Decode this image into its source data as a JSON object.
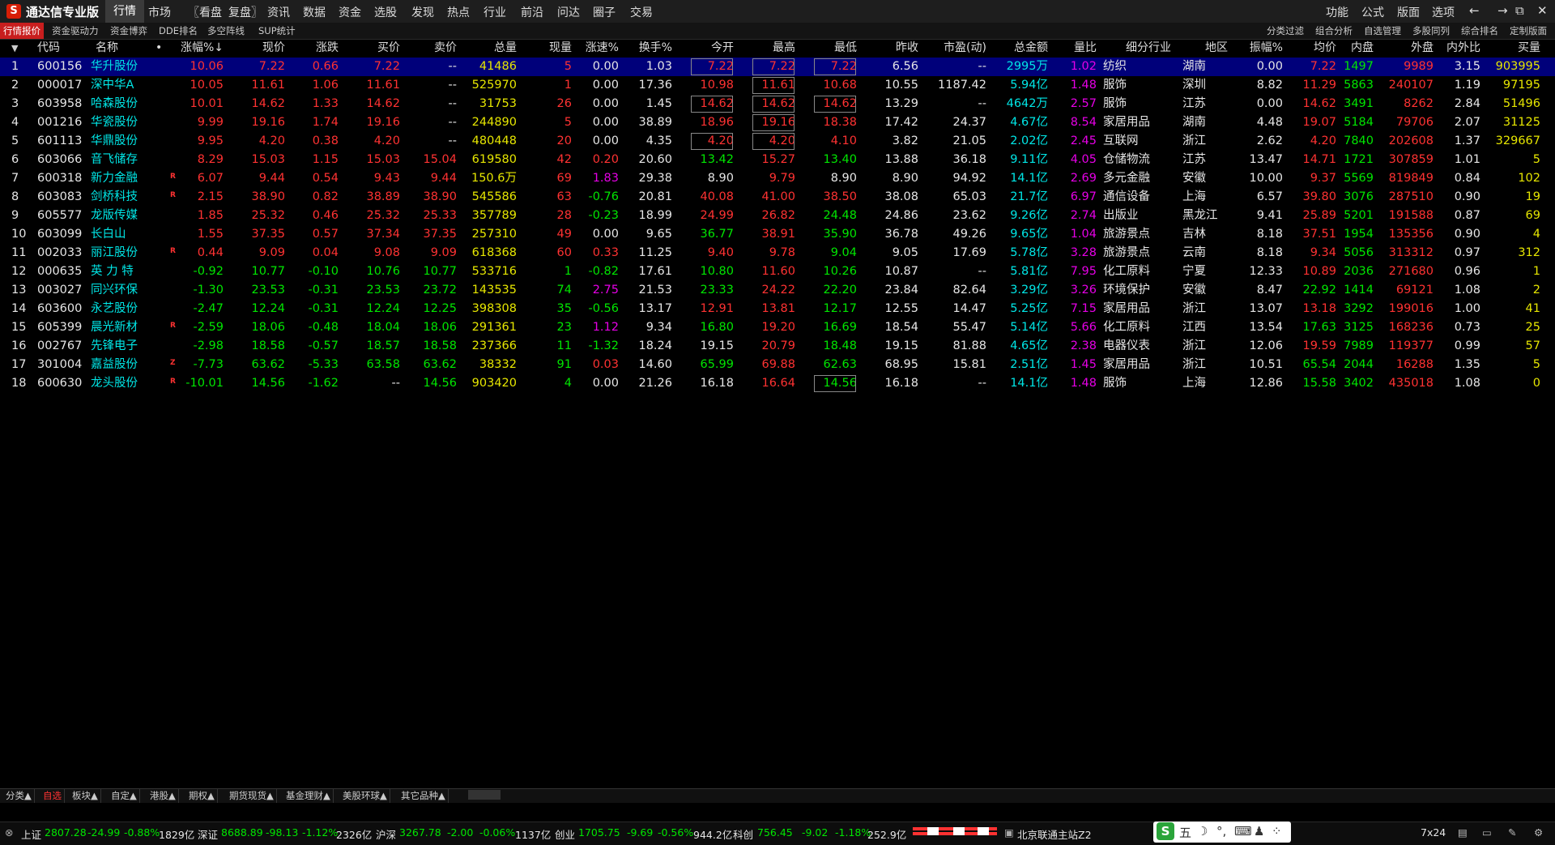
{
  "app": {
    "title": "通达信专业版",
    "logo_text": "S"
  },
  "menu": [
    "行情",
    "市场",
    "〖看盘",
    "复盘〗",
    "资讯",
    "数据",
    "资金",
    "选股",
    "发现",
    "热点",
    "行业",
    "前沿",
    "问达",
    "圈子",
    "交易"
  ],
  "right_menu": [
    "功能",
    "公式",
    "版面",
    "选项"
  ],
  "window_buttons": [
    "←",
    "→",
    "⧉",
    "✕"
  ],
  "tabs": [
    "行情报价",
    "资金驱动力",
    "资金博弈",
    "DDE排名",
    "多空阵线",
    "SUP统计"
  ],
  "right_tabs": [
    "分类过滤",
    "组合分析",
    "自选管理",
    "多股同列",
    "综合排名",
    "定制版面"
  ],
  "columns": [
    "代码",
    "名称",
    "•",
    "涨幅%↓",
    "现价",
    "涨跌",
    "买价",
    "卖价",
    "总量",
    "现量",
    "涨速%",
    "换手%",
    "今开",
    "最高",
    "最低",
    "昨收",
    "市盈(动)",
    "总金额",
    "量比",
    "细分行业",
    "地区",
    "振幅%",
    "均价",
    "内盘",
    "外盘",
    "内外比",
    "买量"
  ],
  "rows": [
    {
      "n": "1",
      "code": "600156",
      "name": "华升股份",
      "mk": "",
      "chg": "10.06",
      "px": "7.22",
      "zd": "0.66",
      "buy": "7.22",
      "sell": "--",
      "vol": "41486",
      "xl": "5",
      "spd": "0.00",
      "hs": "1.03",
      "open": "7.22",
      "high": "7.22",
      "low": "7.22",
      "pc": "6.56",
      "pe": "--",
      "amt": "2995万",
      "lb": "1.02",
      "ind": "纺织",
      "reg": "湖南",
      "amp": "0.00",
      "avg": "7.22",
      "np": "1497",
      "wp": "9989",
      "nwb": "3.15",
      "bv": "903995"
    },
    {
      "n": "2",
      "code": "000017",
      "name": "深中华A",
      "mk": "",
      "chg": "10.05",
      "px": "11.61",
      "zd": "1.06",
      "buy": "11.61",
      "sell": "--",
      "vol": "525970",
      "xl": "1",
      "spd": "0.00",
      "hs": "17.36",
      "open": "10.98",
      "high": "11.61",
      "low": "10.68",
      "pc": "10.55",
      "pe": "1187.42",
      "amt": "5.94亿",
      "lb": "1.48",
      "ind": "服饰",
      "reg": "深圳",
      "amp": "8.82",
      "avg": "11.29",
      "np": "5863",
      "wp": "240107",
      "nwb": "1.19",
      "bv": "97195"
    },
    {
      "n": "3",
      "code": "603958",
      "name": "哈森股份",
      "mk": "",
      "chg": "10.01",
      "px": "14.62",
      "zd": "1.33",
      "buy": "14.62",
      "sell": "--",
      "vol": "31753",
      "xl": "26",
      "spd": "0.00",
      "hs": "1.45",
      "open": "14.62",
      "high": "14.62",
      "low": "14.62",
      "pc": "13.29",
      "pe": "--",
      "amt": "4642万",
      "lb": "2.57",
      "ind": "服饰",
      "reg": "江苏",
      "amp": "0.00",
      "avg": "14.62",
      "np": "3491",
      "wp": "8262",
      "nwb": "2.84",
      "bv": "51496"
    },
    {
      "n": "4",
      "code": "001216",
      "name": "华瓷股份",
      "mk": "",
      "chg": "9.99",
      "px": "19.16",
      "zd": "1.74",
      "buy": "19.16",
      "sell": "--",
      "vol": "244890",
      "xl": "5",
      "spd": "0.00",
      "hs": "38.89",
      "open": "18.96",
      "high": "19.16",
      "low": "18.38",
      "pc": "17.42",
      "pe": "24.37",
      "amt": "4.67亿",
      "lb": "8.54",
      "ind": "家居用品",
      "reg": "湖南",
      "amp": "4.48",
      "avg": "19.07",
      "np": "5184",
      "wp": "79706",
      "nwb": "2.07",
      "bv": "31125"
    },
    {
      "n": "5",
      "code": "601113",
      "name": "华鼎股份",
      "mk": "",
      "chg": "9.95",
      "px": "4.20",
      "zd": "0.38",
      "buy": "4.20",
      "sell": "--",
      "vol": "480448",
      "xl": "20",
      "spd": "0.00",
      "hs": "4.35",
      "open": "4.20",
      "high": "4.20",
      "low": "4.10",
      "pc": "3.82",
      "pe": "21.05",
      "amt": "2.02亿",
      "lb": "2.45",
      "ind": "互联网",
      "reg": "浙江",
      "amp": "2.62",
      "avg": "4.20",
      "np": "7840",
      "wp": "202608",
      "nwb": "1.37",
      "bv": "329667"
    },
    {
      "n": "6",
      "code": "603066",
      "name": "音飞储存",
      "mk": "",
      "chg": "8.29",
      "px": "15.03",
      "zd": "1.15",
      "buy": "15.03",
      "sell": "15.04",
      "vol": "619580",
      "xl": "42",
      "spd": "0.20",
      "hs": "20.60",
      "open": "13.42",
      "high": "15.27",
      "low": "13.40",
      "pc": "13.88",
      "pe": "36.18",
      "amt": "9.11亿",
      "lb": "4.05",
      "ind": "仓储物流",
      "reg": "江苏",
      "amp": "13.47",
      "avg": "14.71",
      "np": "1721",
      "wp": "307859",
      "nwb": "1.01",
      "bv": "5"
    },
    {
      "n": "7",
      "code": "600318",
      "name": "新力金融",
      "mk": "R",
      "chg": "6.07",
      "px": "9.44",
      "zd": "0.54",
      "buy": "9.43",
      "sell": "9.44",
      "vol": "150.6万",
      "xl": "69",
      "spd": "1.83",
      "hs": "29.38",
      "open": "8.90",
      "high": "9.79",
      "low": "8.90",
      "pc": "8.90",
      "pe": "94.92",
      "amt": "14.1亿",
      "lb": "2.69",
      "ind": "多元金融",
      "reg": "安徽",
      "amp": "10.00",
      "avg": "9.37",
      "np": "5569",
      "wp": "819849",
      "nwb": "0.84",
      "bv": "102"
    },
    {
      "n": "8",
      "code": "603083",
      "name": "剑桥科技",
      "mk": "R",
      "chg": "2.15",
      "px": "38.90",
      "zd": "0.82",
      "buy": "38.89",
      "sell": "38.90",
      "vol": "545586",
      "xl": "63",
      "spd": "-0.76",
      "hs": "20.81",
      "open": "40.08",
      "high": "41.00",
      "low": "38.50",
      "pc": "38.08",
      "pe": "65.03",
      "amt": "21.7亿",
      "lb": "6.97",
      "ind": "通信设备",
      "reg": "上海",
      "amp": "6.57",
      "avg": "39.80",
      "np": "3076",
      "wp": "287510",
      "nwb": "0.90",
      "bv": "19"
    },
    {
      "n": "9",
      "code": "605577",
      "name": "龙版传媒",
      "mk": "",
      "chg": "1.85",
      "px": "25.32",
      "zd": "0.46",
      "buy": "25.32",
      "sell": "25.33",
      "vol": "357789",
      "xl": "28",
      "spd": "-0.23",
      "hs": "18.99",
      "open": "24.99",
      "high": "26.82",
      "low": "24.48",
      "pc": "24.86",
      "pe": "23.62",
      "amt": "9.26亿",
      "lb": "2.74",
      "ind": "出版业",
      "reg": "黑龙江",
      "amp": "9.41",
      "avg": "25.89",
      "np": "5201",
      "wp": "191588",
      "nwb": "0.87",
      "bv": "69"
    },
    {
      "n": "10",
      "code": "603099",
      "name": "长白山",
      "mk": "",
      "chg": "1.55",
      "px": "37.35",
      "zd": "0.57",
      "buy": "37.34",
      "sell": "37.35",
      "vol": "257310",
      "xl": "49",
      "spd": "0.00",
      "hs": "9.65",
      "open": "36.77",
      "high": "38.91",
      "low": "35.90",
      "pc": "36.78",
      "pe": "49.26",
      "amt": "9.65亿",
      "lb": "1.04",
      "ind": "旅游景点",
      "reg": "吉林",
      "amp": "8.18",
      "avg": "37.51",
      "np": "1954",
      "wp": "135356",
      "nwb": "0.90",
      "bv": "4"
    },
    {
      "n": "11",
      "code": "002033",
      "name": "丽江股份",
      "mk": "R",
      "chg": "0.44",
      "px": "9.09",
      "zd": "0.04",
      "buy": "9.08",
      "sell": "9.09",
      "vol": "618368",
      "xl": "60",
      "spd": "0.33",
      "hs": "11.25",
      "open": "9.40",
      "high": "9.78",
      "low": "9.04",
      "pc": "9.05",
      "pe": "17.69",
      "amt": "5.78亿",
      "lb": "3.28",
      "ind": "旅游景点",
      "reg": "云南",
      "amp": "8.18",
      "avg": "9.34",
      "np": "5056",
      "wp": "313312",
      "nwb": "0.97",
      "bv": "312"
    },
    {
      "n": "12",
      "code": "000635",
      "name": "英 力 特",
      "mk": "",
      "chg": "-0.92",
      "px": "10.77",
      "zd": "-0.10",
      "buy": "10.76",
      "sell": "10.77",
      "vol": "533716",
      "xl": "1",
      "spd": "-0.82",
      "hs": "17.61",
      "open": "10.80",
      "high": "11.60",
      "low": "10.26",
      "pc": "10.87",
      "pe": "--",
      "amt": "5.81亿",
      "lb": "7.95",
      "ind": "化工原料",
      "reg": "宁夏",
      "amp": "12.33",
      "avg": "10.89",
      "np": "2036",
      "wp": "271680",
      "nwb": "0.96",
      "bv": "1"
    },
    {
      "n": "13",
      "code": "003027",
      "name": "同兴环保",
      "mk": "",
      "chg": "-1.30",
      "px": "23.53",
      "zd": "-0.31",
      "buy": "23.53",
      "sell": "23.72",
      "vol": "143535",
      "xl": "74",
      "spd": "2.75",
      "hs": "21.53",
      "open": "23.33",
      "high": "24.22",
      "low": "22.20",
      "pc": "23.84",
      "pe": "82.64",
      "amt": "3.29亿",
      "lb": "3.26",
      "ind": "环境保护",
      "reg": "安徽",
      "amp": "8.47",
      "avg": "22.92",
      "np": "1414",
      "wp": "69121",
      "nwb": "1.08",
      "bv": "2"
    },
    {
      "n": "14",
      "code": "603600",
      "name": "永艺股份",
      "mk": "",
      "chg": "-2.47",
      "px": "12.24",
      "zd": "-0.31",
      "buy": "12.24",
      "sell": "12.25",
      "vol": "398308",
      "xl": "35",
      "spd": "-0.56",
      "hs": "13.17",
      "open": "12.91",
      "high": "13.81",
      "low": "12.17",
      "pc": "12.55",
      "pe": "14.47",
      "amt": "5.25亿",
      "lb": "7.15",
      "ind": "家居用品",
      "reg": "浙江",
      "amp": "13.07",
      "avg": "13.18",
      "np": "3292",
      "wp": "199016",
      "nwb": "1.00",
      "bv": "41"
    },
    {
      "n": "15",
      "code": "605399",
      "name": "晨光新材",
      "mk": "R",
      "chg": "-2.59",
      "px": "18.06",
      "zd": "-0.48",
      "buy": "18.04",
      "sell": "18.06",
      "vol": "291361",
      "xl": "23",
      "spd": "1.12",
      "hs": "9.34",
      "open": "16.80",
      "high": "19.20",
      "low": "16.69",
      "pc": "18.54",
      "pe": "55.47",
      "amt": "5.14亿",
      "lb": "5.66",
      "ind": "化工原料",
      "reg": "江西",
      "amp": "13.54",
      "avg": "17.63",
      "np": "3125",
      "wp": "168236",
      "nwb": "0.73",
      "bv": "25"
    },
    {
      "n": "16",
      "code": "002767",
      "name": "先锋电子",
      "mk": "",
      "chg": "-2.98",
      "px": "18.58",
      "zd": "-0.57",
      "buy": "18.57",
      "sell": "18.58",
      "vol": "237366",
      "xl": "11",
      "spd": "-1.32",
      "hs": "18.24",
      "open": "19.15",
      "high": "20.79",
      "low": "18.48",
      "pc": "19.15",
      "pe": "81.88",
      "amt": "4.65亿",
      "lb": "2.38",
      "ind": "电器仪表",
      "reg": "浙江",
      "amp": "12.06",
      "avg": "19.59",
      "np": "7989",
      "wp": "119377",
      "nwb": "0.99",
      "bv": "57"
    },
    {
      "n": "17",
      "code": "301004",
      "name": "嘉益股份",
      "mk": "Z",
      "chg": "-7.73",
      "px": "63.62",
      "zd": "-5.33",
      "buy": "63.58",
      "sell": "63.62",
      "vol": "38332",
      "xl": "91",
      "spd": "0.03",
      "hs": "14.60",
      "open": "65.99",
      "high": "69.88",
      "low": "62.63",
      "pc": "68.95",
      "pe": "15.81",
      "amt": "2.51亿",
      "lb": "1.45",
      "ind": "家居用品",
      "reg": "浙江",
      "amp": "10.51",
      "avg": "65.54",
      "np": "2044",
      "wp": "16288",
      "nwb": "1.35",
      "bv": "5"
    },
    {
      "n": "18",
      "code": "600630",
      "name": "龙头股份",
      "mk": "R",
      "chg": "-10.01",
      "px": "14.56",
      "zd": "-1.62",
      "buy": "--",
      "sell": "14.56",
      "vol": "903420",
      "xl": "4",
      "spd": "0.00",
      "hs": "21.26",
      "open": "16.18",
      "high": "16.64",
      "low": "14.56",
      "pc": "16.18",
      "pe": "--",
      "amt": "14.1亿",
      "lb": "1.48",
      "ind": "服饰",
      "reg": "上海",
      "amp": "12.86",
      "avg": "15.58",
      "np": "3402",
      "wp": "435018",
      "nwb": "1.08",
      "bv": "0"
    }
  ],
  "bottom_tabs": [
    "分类▲",
    "自选",
    "板块▲",
    "自定▲",
    "港股▲",
    "期权▲",
    "期货现货▲",
    "基金理财▲",
    "美股环球▲",
    "其它品种▲"
  ],
  "status": {
    "sh": {
      "label": "上证",
      "price": "2807.28",
      "chg": "-24.99",
      "pct": "-0.88%",
      "amt": "1829亿"
    },
    "sz": {
      "label": "深证",
      "price": "8688.89",
      "chg": "-98.13",
      "pct": "-1.12%",
      "amt": "2326亿"
    },
    "hs": {
      "label": "沪深",
      "price": "3267.78",
      "chg": "-2.00",
      "pct": "-0.06%",
      "amt": "1137亿"
    },
    "cy": {
      "label": "创业",
      "price": "1705.75",
      "chg": "-9.69",
      "pct": "-0.56%",
      "amt": "944.2亿"
    },
    "kc": {
      "label": "科创",
      "price": "756.45",
      "chg": "-9.02",
      "pct": "-1.18%",
      "amt": "252.9亿"
    },
    "server": "北京联通主站Z2",
    "ime_mode": "五",
    "clock": "7x24"
  },
  "colors": {
    "up": "#ff3232",
    "down": "#00e600",
    "selected_row": "#00007a",
    "active_tab": "#c81e1e"
  }
}
